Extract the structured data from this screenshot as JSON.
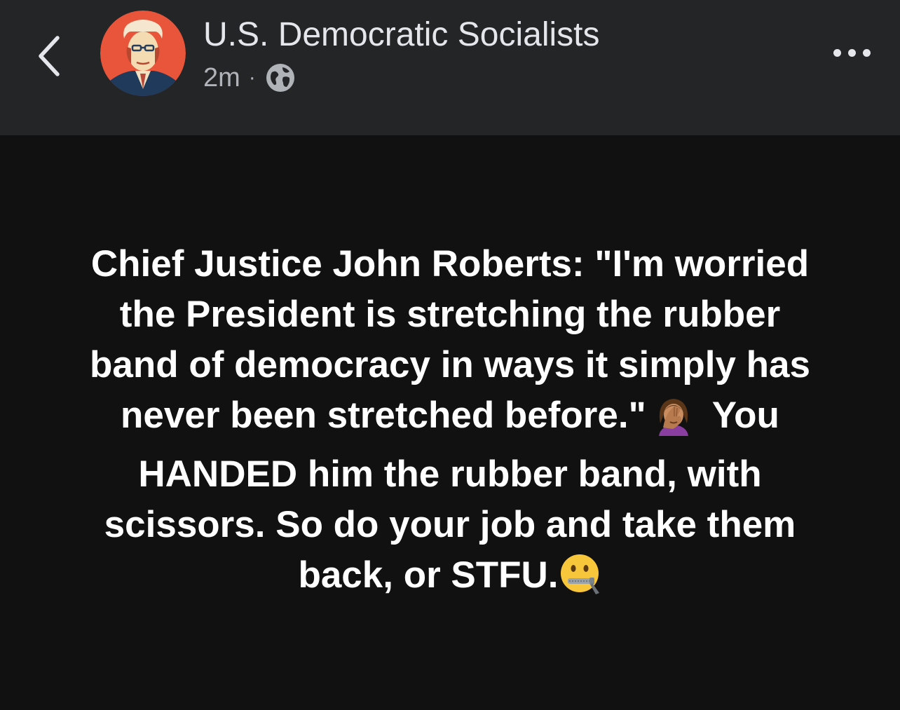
{
  "header": {
    "back_icon": "chevron-left-icon",
    "page_name": "U.S. Democratic Socialists",
    "timestamp": "2m",
    "separator": "·",
    "audience_icon": "globe-icon",
    "more_icon": "more-horizontal-icon"
  },
  "post": {
    "text_part1": "Chief Justice John Roberts: \"I'm worried the President is stretching the rubber band of democracy in ways it simply has never been stretched before.\"",
    "emoji1": "face-palm-emoji",
    "text_part2": "You HANDED him the rubber band, with scissors. So do your job and take them back, or STFU.",
    "emoji2": "zipper-mouth-face-emoji",
    "background_color": "#111112",
    "text_color": "#ffffff"
  },
  "colors": {
    "header_bg": "#242526",
    "primary_text": "#e4e6eb",
    "secondary_text": "#b0b3b8"
  }
}
